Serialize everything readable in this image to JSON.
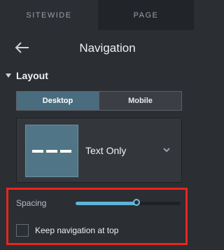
{
  "tabs": {
    "sitewide": "SITEWIDE",
    "page": "PAGE"
  },
  "header": {
    "title": "Navigation",
    "back_icon": "back-arrow-icon"
  },
  "layout": {
    "label": "Layout",
    "modes": {
      "desktop": "Desktop",
      "mobile": "Mobile",
      "selected": "Desktop"
    },
    "style": {
      "selected": "Text Only"
    }
  },
  "settings": {
    "spacing_label": "Spacing",
    "spacing_value": 0.58,
    "keep_nav_label": "Keep navigation at top",
    "keep_nav_checked": false
  },
  "colors": {
    "accent": "#5fb3d6",
    "selected": "#496c7e",
    "highlight": "#e8261c"
  }
}
